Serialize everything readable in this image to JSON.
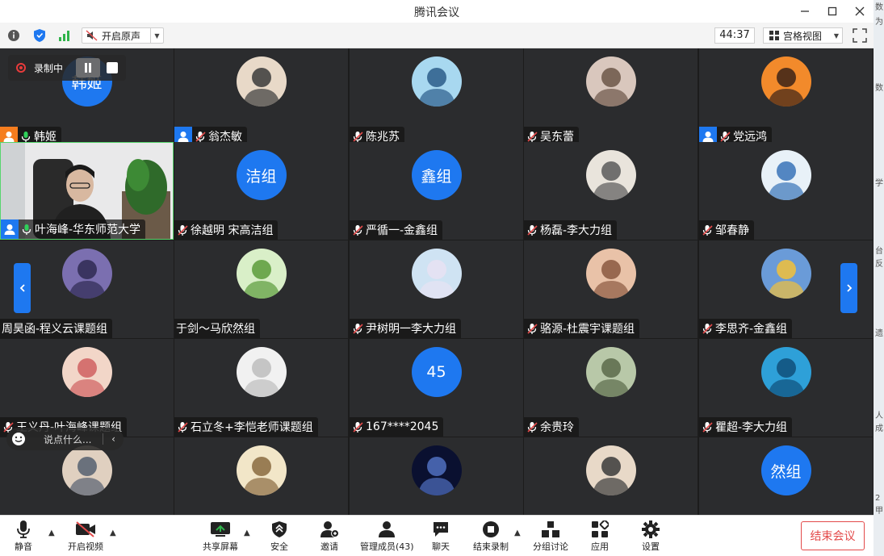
{
  "window": {
    "title": "腾讯会议"
  },
  "toolbar": {
    "original_sound_label": "开启原声",
    "timer": "44:37",
    "view_label": "宫格视图"
  },
  "recording": {
    "label": "录制中"
  },
  "chat": {
    "placeholder": "说点什么..."
  },
  "participants": [
    {
      "name": "韩姬",
      "avatar_text": "韩姬",
      "avatar_color": "#1e78f0",
      "host": "orange",
      "mic": "on"
    },
    {
      "name": "翁杰敏",
      "host": "blue",
      "mic": "muted"
    },
    {
      "name": "陈兆苏",
      "mic": "muted"
    },
    {
      "name": "吴东蕾",
      "mic": "muted"
    },
    {
      "name": "党远鸿",
      "host": "blue",
      "mic": "muted"
    },
    {
      "name": "叶海峰-华东师范大学",
      "host": "blue",
      "mic": "on",
      "video": true
    },
    {
      "name": "徐越明 宋高洁组",
      "avatar_text": "洁组",
      "avatar_color": "#1e78f0",
      "mic": "muted"
    },
    {
      "name": "严循一-金鑫组",
      "avatar_text": "鑫组",
      "avatar_color": "#1e78f0",
      "mic": "muted"
    },
    {
      "name": "杨磊-李大力组",
      "mic": "muted"
    },
    {
      "name": "邹春静",
      "mic": "muted"
    },
    {
      "name": "周昊函-程义云课题组",
      "mic": "none"
    },
    {
      "name": "于剑～马欣然组",
      "mic": "none"
    },
    {
      "name": "尹树明一李大力组",
      "mic": "muted"
    },
    {
      "name": "骆源-杜震宇课题组",
      "mic": "muted"
    },
    {
      "name": "李思齐-金鑫组",
      "mic": "muted"
    },
    {
      "name": "王义丹-叶海峰课题组",
      "mic": "muted"
    },
    {
      "name": "石立冬+李恺老师课题组",
      "mic": "muted"
    },
    {
      "name": "167****2045",
      "avatar_text": "45",
      "avatar_color": "#1e78f0",
      "mic": "muted"
    },
    {
      "name": "余贵玲",
      "mic": "muted"
    },
    {
      "name": "瞿超-李大力组",
      "mic": "muted"
    },
    {
      "name": "",
      "mic": "none"
    },
    {
      "name": "",
      "mic": "none"
    },
    {
      "name": "",
      "mic": "none"
    },
    {
      "name": "",
      "mic": "none"
    },
    {
      "name": "",
      "avatar_text": "然组",
      "avatar_color": "#1e78f0",
      "mic": "none"
    }
  ],
  "bottombar": {
    "mute": "静音",
    "video": "开启视频",
    "share": "共享屏幕",
    "security": "安全",
    "invite": "邀请",
    "members": "管理成员(43)",
    "chat": "聊天",
    "end_recording": "结束录制",
    "breakout": "分组讨论",
    "apps": "应用",
    "settings": "设置",
    "end_meeting": "结束会议"
  },
  "right_strip": {
    "fragments": [
      "数",
      "为",
      "数",
      "学",
      "台",
      "反",
      "遗",
      "人",
      "成",
      "2",
      "甲"
    ]
  },
  "colors": {
    "accent": "#1e78f0",
    "danger": "#e34a4a",
    "tile_bg": "#2b2c2e",
    "active_border": "#57d66d"
  }
}
